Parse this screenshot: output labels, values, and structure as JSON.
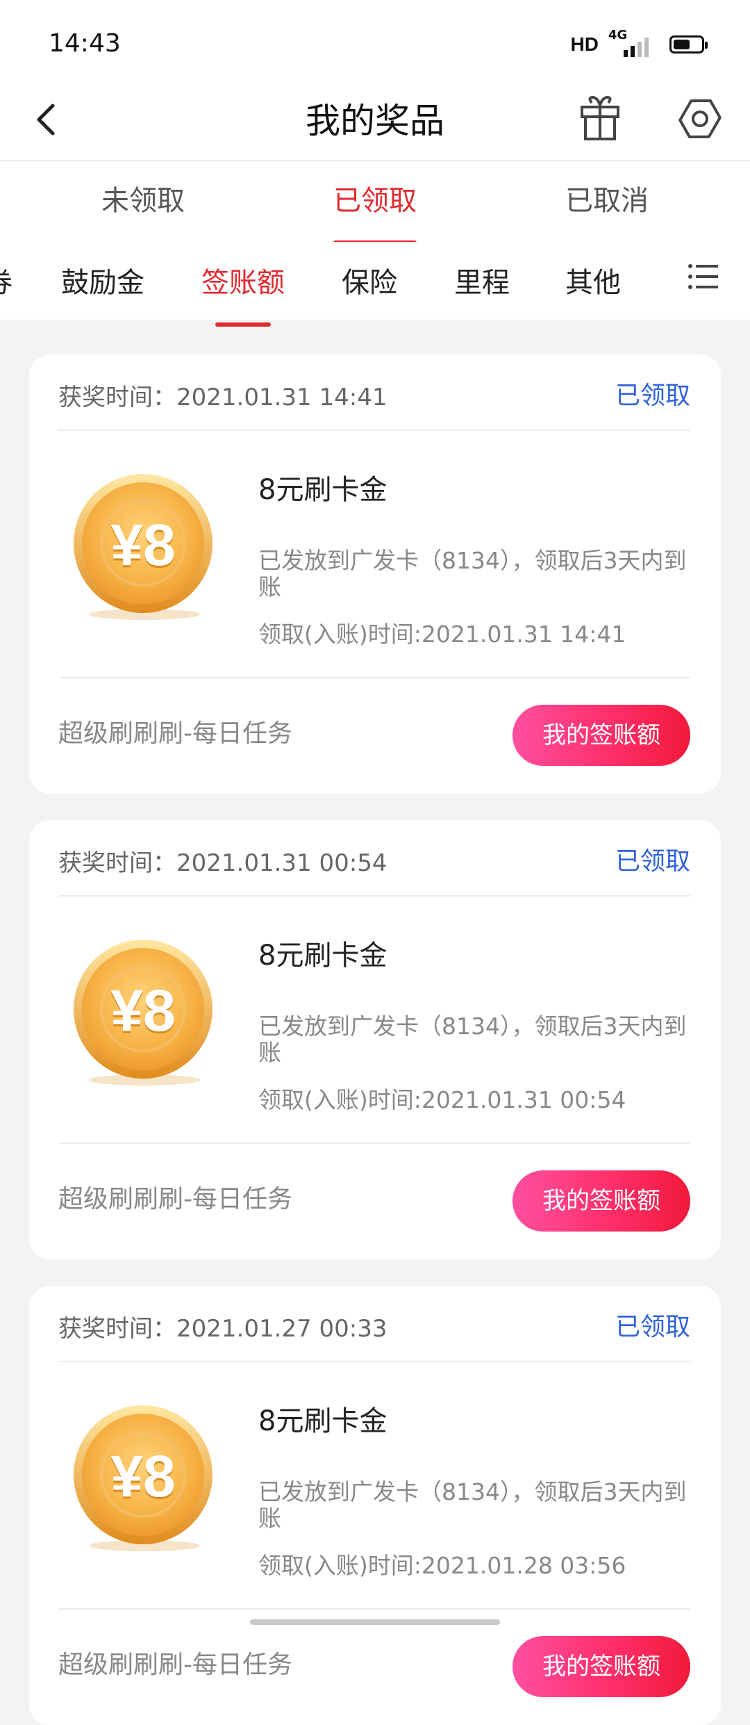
{
  "status_bar": {
    "time": "14:43",
    "hd": "HD",
    "network": "4G",
    "battery_percent": 60
  },
  "header": {
    "title": "我的奖品",
    "icons": [
      "back-icon",
      "gift-icon",
      "settings-icon"
    ]
  },
  "main_tabs": [
    {
      "label": "未领取",
      "active": false
    },
    {
      "label": "已领取",
      "active": true
    },
    {
      "label": "已取消",
      "active": false
    }
  ],
  "sub_tabs": [
    {
      "label": "券",
      "active": false
    },
    {
      "label": "鼓励金",
      "active": false
    },
    {
      "label": "签账额",
      "active": true
    },
    {
      "label": "保险",
      "active": false
    },
    {
      "label": "里程",
      "active": false
    },
    {
      "label": "其他",
      "active": false
    }
  ],
  "cards": [
    {
      "award_time": "获奖时间：2021.01.31 14:41",
      "status": "已领取",
      "coin_label": "¥8",
      "title": "8元刷卡金",
      "description": "已发放到广发卡（8134），领取后3天内到账",
      "claim_time": "领取(入账)时间:2021.01.31 14:41",
      "source": "超级刷刷刷-每日任务",
      "button": "我的签账额"
    },
    {
      "award_time": "获奖时间：2021.01.31 00:54",
      "status": "已领取",
      "coin_label": "¥8",
      "title": "8元刷卡金",
      "description": "已发放到广发卡（8134），领取后3天内到账",
      "claim_time": "领取(入账)时间:2021.01.31 00:54",
      "source": "超级刷刷刷-每日任务",
      "button": "我的签账额"
    },
    {
      "award_time": "获奖时间：2021.01.27 00:33",
      "status": "已领取",
      "coin_label": "¥8",
      "title": "8元刷卡金",
      "description": "已发放到广发卡（8134），领取后3天内到账",
      "claim_time": "领取(入账)时间:2021.01.28 03:56",
      "source": "超级刷刷刷-每日任务",
      "button": "我的签账额"
    }
  ],
  "colors": {
    "accent_red": "#e02a2f",
    "status_blue": "#2f63d8",
    "coin_gold": "#f5a623"
  }
}
